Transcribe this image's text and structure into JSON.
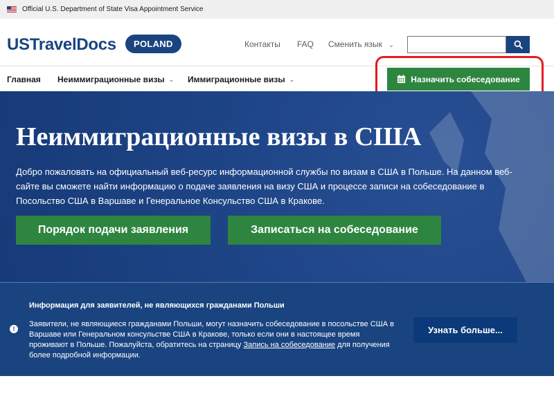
{
  "banner": {
    "text": "Official U.S. Department of State Visa Appointment Service",
    "flag_icon": "us-flag-icon"
  },
  "header": {
    "logo": "USTravelDocs",
    "badge": "POLAND",
    "links": {
      "contacts": "Контакты",
      "faq": "FAQ",
      "language": "Сменить язык"
    },
    "search": {
      "value": "",
      "placeholder": "",
      "icon": "search-icon"
    }
  },
  "nav": {
    "home": "Главная",
    "nonimmigrant": "Неиммиграционные визы",
    "immigrant": "Иммиграционные визы",
    "cta": "Назначить собеседование",
    "cta_icon": "calendar-icon"
  },
  "hero": {
    "title": "Неиммиграционные визы в США",
    "text": "Добро пожаловать на официальный веб-ресурс информационной службы по визам в США в Польше. На данном веб-сайте вы сможете найти информацию о подаче заявления на визу США и процессе записи на собеседование в Посольство США в Варшаве и Генеральное Консульство США в Кракове.",
    "apply_button": "Порядок подачи заявления",
    "schedule_button": "Записаться на собеседование"
  },
  "alert": {
    "title": "Информация для заявителей, не являющихся гражданами Польши",
    "text_before": "Заявители, не являющиеся гражданами Польши, могут назначить собеседование в посольстве США в Варшаве или Генеральном консульстве США в Кракове, только если они в настоящее время проживают в Польше. Пожалуйста, обратитесь на страницу ",
    "link": "Запись на собеседование",
    "text_after": " для получения более подробной информации.",
    "button": "Узнать больше...",
    "icon": "info-icon"
  },
  "colors": {
    "brand": "#1a4480",
    "green": "#2e8540",
    "highlight": "#e41b23"
  }
}
